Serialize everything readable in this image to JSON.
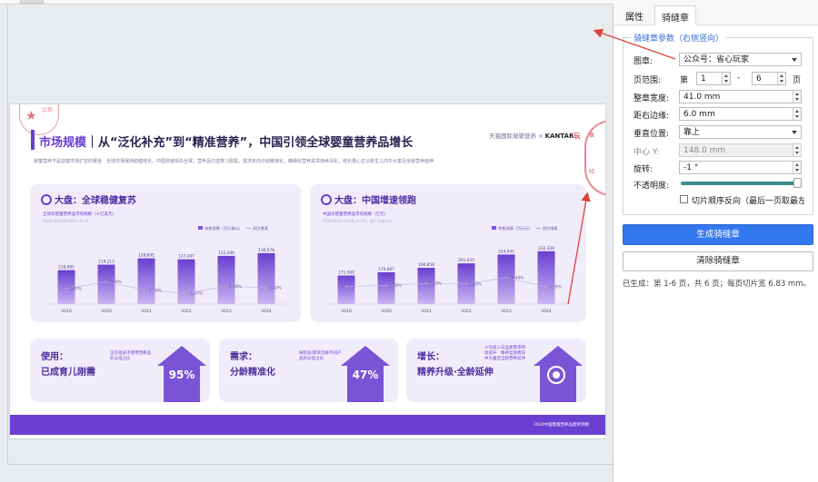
{
  "slide": {
    "seal_left_text": "公司",
    "title_lead": "市场规模",
    "title_rest": "｜从“泛化补充”到“精准营养”，中国引领全球婴童营养品增长",
    "logos": "天猫国际母婴营养 × ",
    "logo_kantar": "KANTAR",
    "logo_tail": "玩",
    "subtitle": "婴童营养不是亚健市场扩容的赛道　全球市场保持稳健增长，中国增速领先全球；营养品已成育儿刚需，需求走向分龄精准化；精细化营养需求持续深化，增长重心正从新生儿向中大童及全龄营养延伸",
    "stamp_right": [
      "章",
      "玩",
      "",
      "",
      "",
      "",
      "",
      "",
      "印"
    ],
    "panel_a": {
      "head": "大盘：全球稳健复苏",
      "desc": "全球孕婴童营养品市场规模（十亿美元）",
      "desc2": "2019-2024年CAGR≈4.2%",
      "legend_bar": "销售规模（百万美元）",
      "legend_line": "同比增速"
    },
    "panel_b": {
      "head": "大盘：中国增速领跑",
      "desc": "中国孕婴童营养品市场规模（亿元）",
      "desc2": "2019-2024 CAGR≈6.7%，高于全球平均",
      "legend_bar": "销售规模（百万元）",
      "legend_line": "同比增速"
    },
    "card1": {
      "title1": "使用：",
      "title2": "已成育儿刚需",
      "note": "正在给孩子使用营养品的父母占比",
      "pct": "95%"
    },
    "card2": {
      "title1": "需求：",
      "title2": "分龄精准化",
      "note": "按阶段/需求选择不同产品的父母占比",
      "pct": "47%"
    },
    "card3": {
      "title1": "增长：",
      "title2": "精养升级·全龄延伸",
      "note": "人均投入与品类需求持续提升　精养型消费向中大童及全龄营养延伸"
    },
    "footer": "2024中国婴童营养品趋势洞察"
  },
  "chart_data": [
    {
      "type": "bar",
      "categories": [
        "2019",
        "2020",
        "2021",
        "2022",
        "2023",
        "2024"
      ],
      "series": [
        {
          "name": "销售规模（百万美元）",
          "values": [
            110985,
            119213,
            128691,
            127247,
            132446,
            136578
          ]
        },
        {
          "name": "同比增速",
          "values": [
            2.4,
            7.4,
            1.1,
            -1.1,
            4.1,
            3.0
          ]
        }
      ],
      "bar_labels": [
        "110,985",
        "119,213",
        "128,691",
        "127,247",
        "132,446",
        "136,578"
      ],
      "line_labels": [
        "2.40%",
        "7.90%",
        "1.10%",
        "-1.10%",
        "4.10%",
        "3.00%"
      ],
      "ylim": [
        60000,
        150000
      ],
      "line_ylim": [
        -5,
        15
      ]
    },
    {
      "type": "bar",
      "categories": [
        "2019",
        "2020",
        "2021",
        "2022",
        "2023",
        "2024"
      ],
      "series": [
        {
          "name": "销售规模（百万元）",
          "values": [
            171569,
            179687,
            190858,
            201935,
            224041,
            232339
          ]
        },
        {
          "name": "同比增速",
          "values": [
            4.0,
            4.7,
            6.2,
            5.8,
            10.4,
            3.7
          ]
        }
      ],
      "bar_labels": [
        "171,569",
        "179,687",
        "190,858",
        "201,935",
        "224,041",
        "232,339"
      ],
      "line_labels": [
        "",
        "4.70%",
        "6.20%",
        "5.80%",
        "10.40%",
        "3.70%"
      ],
      "ylim": [
        100000,
        250000
      ],
      "line_ylim": [
        -5,
        15
      ]
    }
  ],
  "panel": {
    "tabs": {
      "props": "属性",
      "seam": "骑缝章"
    },
    "group_title": "骑缝章参数（右侧竖向）",
    "seal_label": "图章:",
    "seal_value": "公众号：省心玩家",
    "range_label": "页范围:",
    "range_di": "第",
    "range_from": "1",
    "range_dash": "-",
    "range_to": "6",
    "range_ye": "页",
    "width_label": "整章宽度:",
    "width_value": "41.0 mm",
    "margin_label": "距右边缘:",
    "margin_value": "6.0 mm",
    "vpos_label": "垂直位置:",
    "vpos_value": "靠上",
    "cy_label": "中心 Y:",
    "cy_value": "148.0 mm",
    "rot_label": "旋转:",
    "rot_value": "-1 °",
    "opacity_label": "不透明度:",
    "opacity": 1.0,
    "reverse_label": "切片顺序反向（最后一页取最左侧）",
    "generate_label": "生成骑缝章",
    "clear_label": "清除骑缝章",
    "status": "已生成：第 1-6 页，共 6 页；每页切片宽 6.83 mm。"
  },
  "colors": {
    "accent": "#3478f0",
    "brand_purple": "#6a3fd1",
    "arrow_red": "#d9453a",
    "slider": "#3e8c89"
  }
}
